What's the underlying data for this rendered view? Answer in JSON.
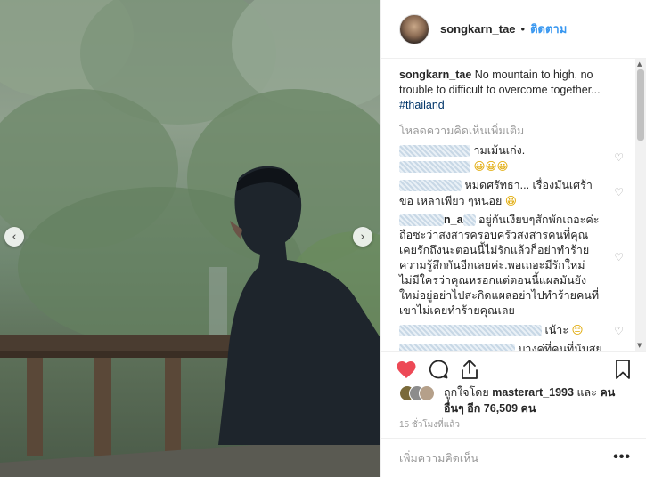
{
  "header": {
    "username": "songkarn_tae",
    "separator": "•",
    "follow_label": "ติดตาม"
  },
  "caption": {
    "username": "songkarn_tae",
    "text": "No mountain to high, no trouble to difficult to overcome together...",
    "hashtag": "#thailand"
  },
  "load_more_label": "โหลดความคิดเห็นเพิ่มเติม",
  "comments": [
    {
      "text": "ามเม้นเก่ง.",
      "text2": "😀😀😀"
    },
    {
      "text": "หมดศรัทธา... เรื่องมันเศร้าขอ เหลาเพียว ๆหน่อย",
      "emoji": "😀"
    },
    {
      "handle": "n_a",
      "text": "อยู่กันเงียบๆสักพักเถอะค่ะ ถือซะว่าสงสารครอบครัวสงสารคนที่คุณเคยรักถึงนะตอนนี้ไม่รักแล้วก็อย่าทำร้ายความรู้สึกกันอีกเลยค่ะ.พอเถอะมีรักใหม่ไม่มีใครว่าคุณหรอกแต่ตอนนี้แผลมันยังใหม่อยู่อย่าไปสะกิดแผลอย่าไปทำร้ายคนที่เขาไม่เคยทำร้ายคุณเลย"
    },
    {
      "text": "เน้าะ",
      "emoji": "😑"
    },
    {
      "text": "บางคู่ที่คนที่นับสย"
    }
  ],
  "likes": {
    "prefix": "ถูกใจโดย",
    "user": "masterart_1993",
    "conj": "และ",
    "others": "คนอื่นๆ อีก 76,509 คน"
  },
  "timestamp": "15 ชั่วโมงที่แล้ว",
  "add_comment_placeholder": "เพิ่มความคิดเห็น",
  "more_label": "•••",
  "icons": {
    "like": "heart-filled-icon",
    "comment": "comment-icon",
    "share": "share-icon",
    "save": "bookmark-icon",
    "prev": "chevron-left-icon",
    "next": "chevron-right-icon"
  },
  "colors": {
    "like_red": "#ed4956",
    "link_blue": "#3897f0",
    "hashtag": "#003569"
  }
}
